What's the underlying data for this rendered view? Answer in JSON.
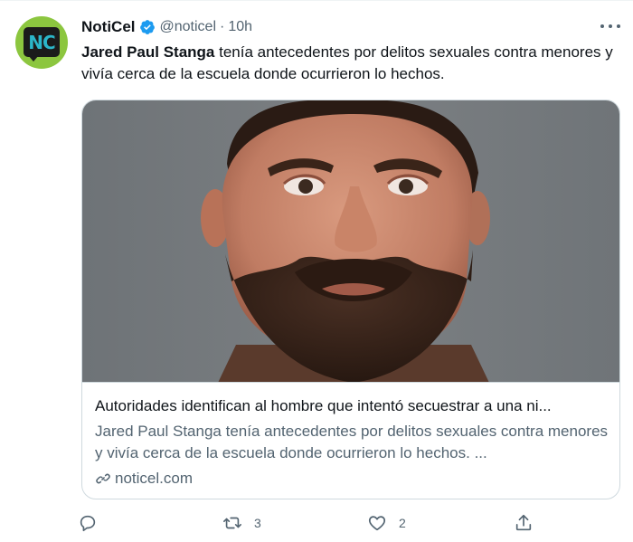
{
  "tweet": {
    "author": {
      "display_name": "NotiCel",
      "handle": "@noticel",
      "time": "10h",
      "avatar_text": "NC",
      "verified": true,
      "dot": "·"
    },
    "text": {
      "bold": "Jared Paul Stanga",
      "rest": " tenía antecedentes por delitos sexuales contra menores y vivía cerca de la escuela donde ocurrieron lo hechos."
    },
    "card": {
      "title": "Autoridades identifican al hombre que intentó secuestrar a una ni...",
      "description": "Jared Paul Stanga tenía antecedentes por delitos sexuales contra menores y vivía cerca de la escuela donde ocurrieron lo hechos. ...",
      "domain": "noticel.com"
    },
    "actions": {
      "retweets": "3",
      "likes": "2"
    }
  },
  "colors": {
    "brand_green": "#8cc63f",
    "verified_blue": "#1d9bf0",
    "secondary_text": "#536471",
    "border": "#cfd9de"
  }
}
